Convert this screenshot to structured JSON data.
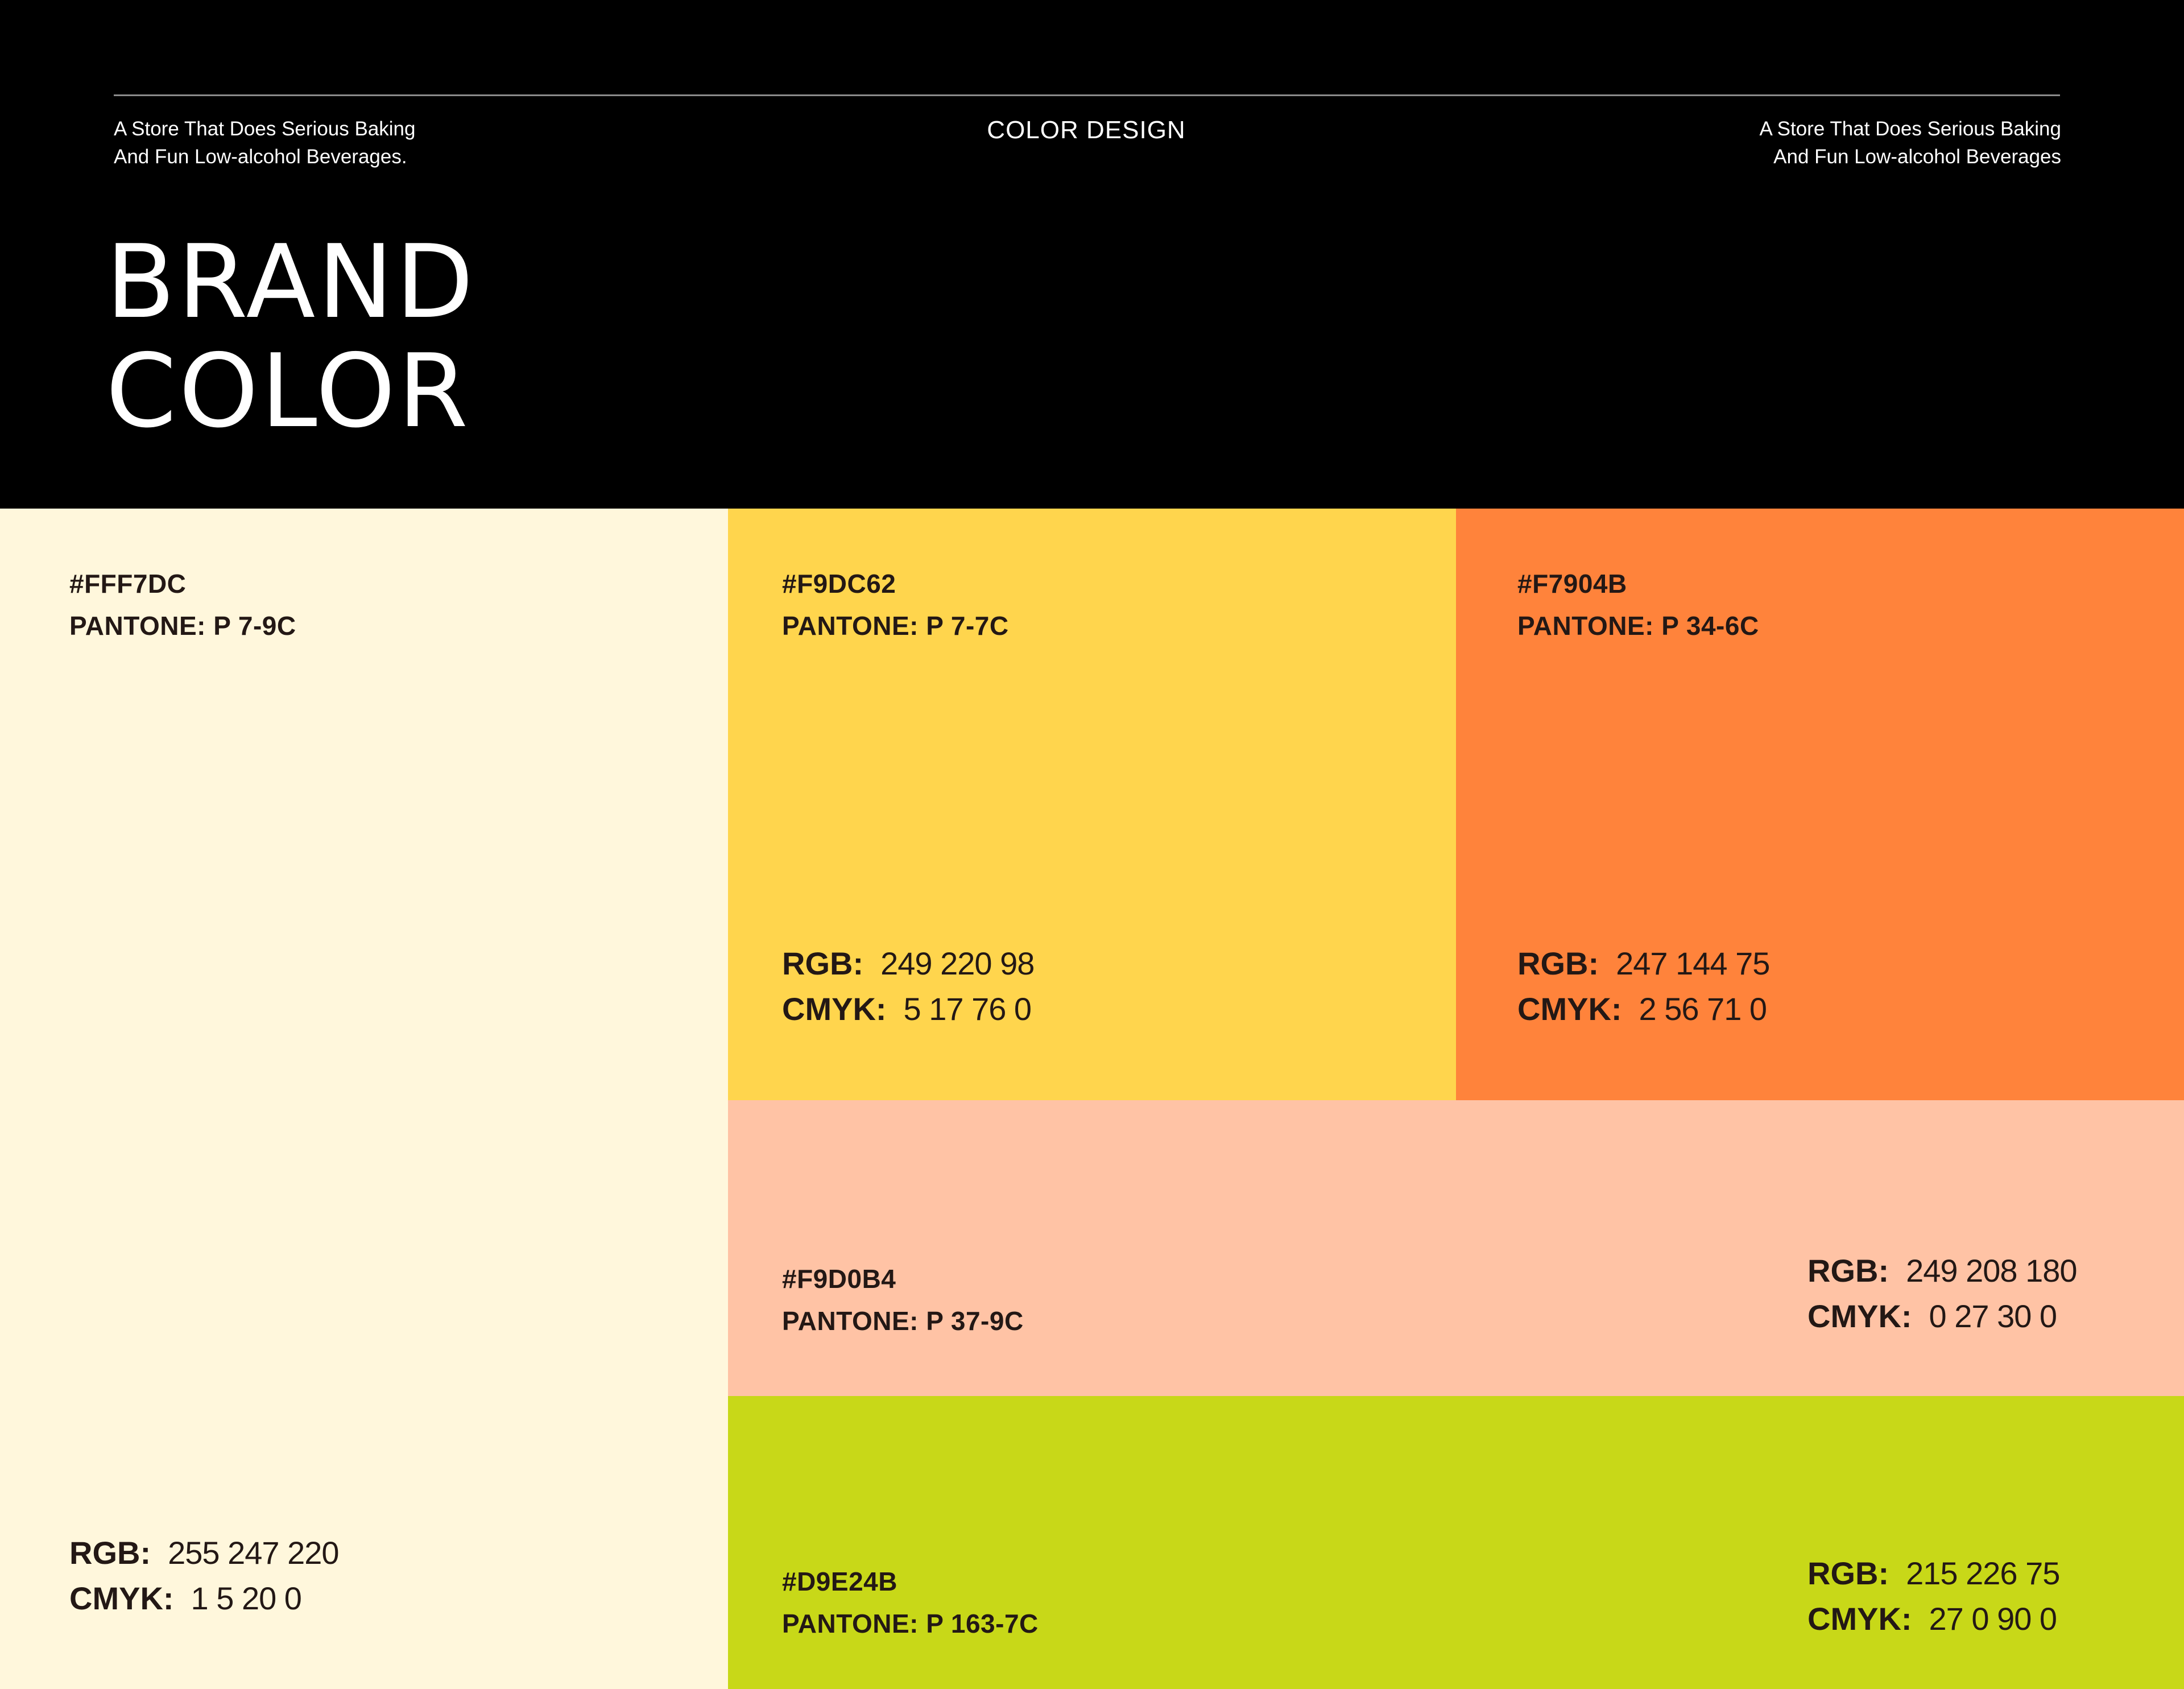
{
  "header": {
    "tagline_left": [
      "A Store That Does Serious Baking",
      "And Fun Low-alcohol Beverages."
    ],
    "center_label": "COLOR DESIGN",
    "tagline_right": [
      "A Store That Does Serious Baking",
      "And Fun Low-alcohol Beverages"
    ],
    "title_lines": [
      "BRAND",
      "COLOR"
    ]
  },
  "spec_labels": {
    "rgb": "RGB:",
    "cmyk": "CMYK:"
  },
  "swatches": [
    {
      "hex": "#FFF7DC",
      "pantone": "PANTONE: P 7-9C",
      "rgb": "255 247 220",
      "cmyk": "1 5 20 0",
      "color": "#FFF7DC"
    },
    {
      "hex": "#F9DC62",
      "pantone": "PANTONE: P 7-7C",
      "rgb": "249 220 98",
      "cmyk": "5 17 76 0",
      "color": "#FFD54D"
    },
    {
      "hex": "#F7904B",
      "pantone": "PANTONE: P 34-6C",
      "rgb": "247 144 75",
      "cmyk": "2 56 71 0",
      "color": "#FF833B"
    },
    {
      "hex": "#F9D0B4",
      "pantone": "PANTONE: P 37-9C",
      "rgb": "249 208 180",
      "cmyk": "0 27 30 0",
      "color": "#FFC3A5"
    },
    {
      "hex": "#D9E24B",
      "pantone": "PANTONE: P 163-7C",
      "rgb": "215 226 75",
      "cmyk": "27 0 90 0",
      "color": "#C8D818"
    }
  ]
}
